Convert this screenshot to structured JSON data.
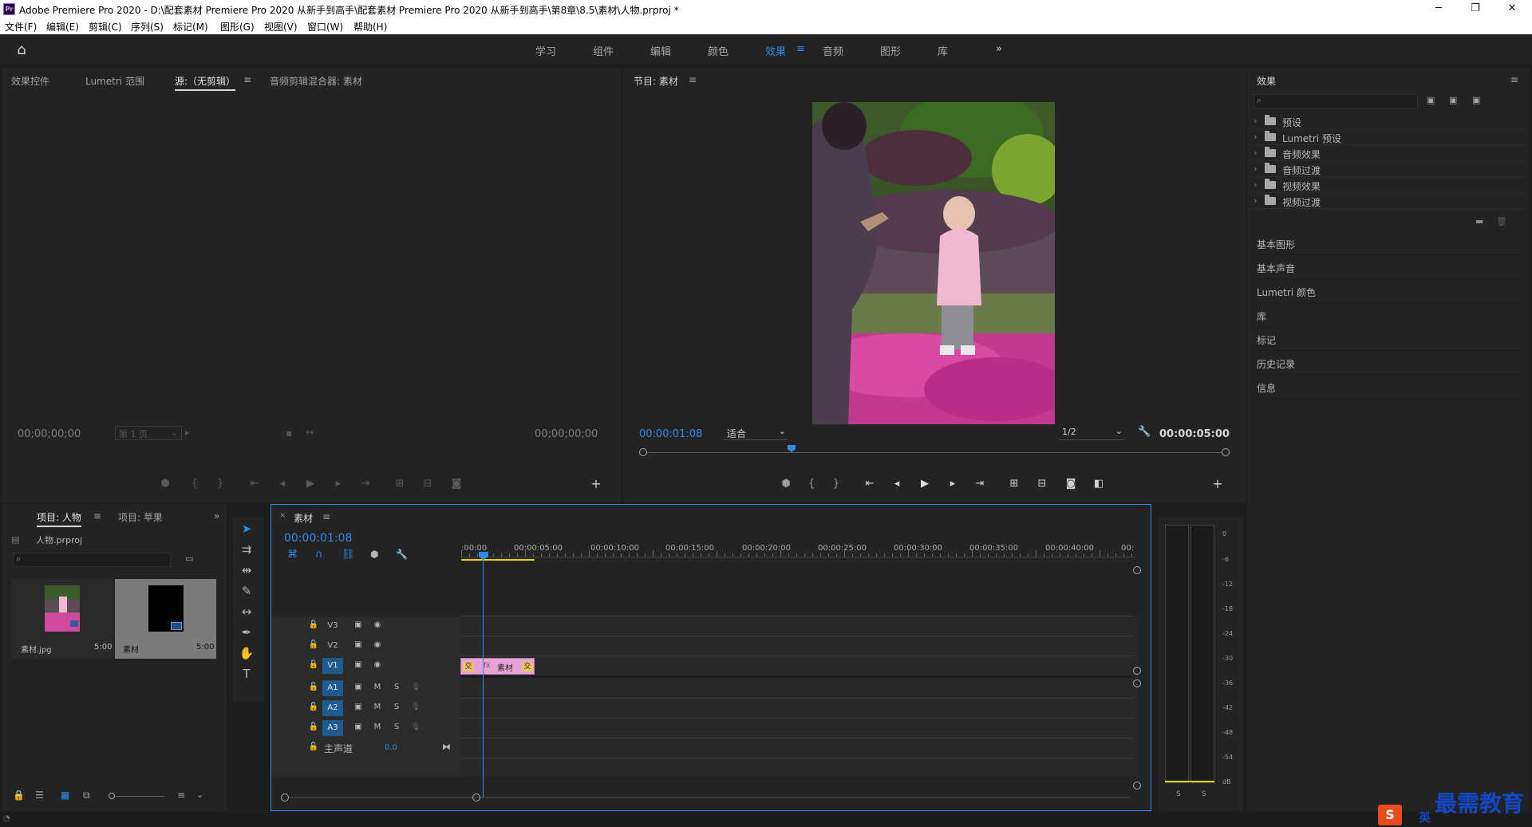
{
  "window": {
    "title": "Adobe Premiere Pro 2020 - D:\\配套素材 Premiere Pro 2020 从新手到高手\\配套素材 Premiere Pro 2020 从新手到高手\\第8章\\8.5\\素材\\人物.prproj *",
    "app_icon": "Pr",
    "controls": [
      "─",
      "❐",
      "✕"
    ]
  },
  "menu": [
    "文件(F)",
    "编辑(E)",
    "剪辑(C)",
    "序列(S)",
    "标记(M)",
    "图形(G)",
    "视图(V)",
    "窗口(W)",
    "帮助(H)"
  ],
  "workspaces": {
    "items": [
      "学习",
      "组件",
      "编辑",
      "颜色",
      "效果",
      "音频",
      "图形",
      "库"
    ],
    "active": "效果",
    "more": "»"
  },
  "source_panel": {
    "tabs": [
      "效果控件",
      "Lumetri 范围",
      "源:（无剪辑）",
      "音频剪辑混合器: 素材"
    ],
    "active_tab": "源:（无剪辑）",
    "timecode_left": "00;00;00;00",
    "page_select": "第 1 页",
    "timecode_right": "00;00;00;00"
  },
  "program_panel": {
    "title": "节目: 素材",
    "timecode": "00:00:01:08",
    "fit": "适合",
    "resolution": "1/2",
    "duration": "00:00:05:00"
  },
  "effects_panel": {
    "title": "效果",
    "search_placeholder": "",
    "folders": [
      "预设",
      "Lumetri 预设",
      "音频效果",
      "音频过渡",
      "视频效果",
      "视频过渡"
    ],
    "sections": [
      "基本图形",
      "基本声音",
      "Lumetri 颜色",
      "库",
      "标记",
      "历史记录",
      "信息"
    ]
  },
  "project_panel": {
    "tabs": [
      "项目: 人物",
      "项目: 苹果"
    ],
    "active_tab": "项目: 人物",
    "file": "人物.prproj",
    "items": [
      {
        "name": "素材.jpg",
        "duration": "5:00"
      },
      {
        "name": "素材",
        "duration": "5:00"
      }
    ]
  },
  "timeline": {
    "tab": "素材",
    "timecode": "00:00:01:08",
    "ruler": [
      ":00:00",
      "00:00:05:00",
      "00:00:10:00",
      "00:00:15:00",
      "00:00:20:00",
      "00:00:25:00",
      "00:00:30:00",
      "00:00:35:00",
      "00:00:40:00",
      "00:"
    ],
    "video_tracks": [
      "V3",
      "V2",
      "V1"
    ],
    "audio_tracks": [
      "A1",
      "A2",
      "A3"
    ],
    "track_m": "M",
    "track_s": "S",
    "master_label": "主声道",
    "master_value": "0.0",
    "clip_name": "素材",
    "clip_badge": "fx",
    "transition_label": "交"
  },
  "audio_meter": {
    "scale": [
      "0",
      "-6",
      "-12",
      "-18",
      "-24",
      "-30",
      "-36",
      "-42",
      "-48",
      "-54",
      "dB"
    ],
    "solo": [
      "S",
      "S"
    ]
  },
  "watermark": {
    "text": "最需教育",
    "ime": "英"
  },
  "colors": {
    "accent": "#2d8ceb",
    "panel_bg": "#232323",
    "clip_pink": "#e8a3d6",
    "work_area": "#e5d400"
  }
}
